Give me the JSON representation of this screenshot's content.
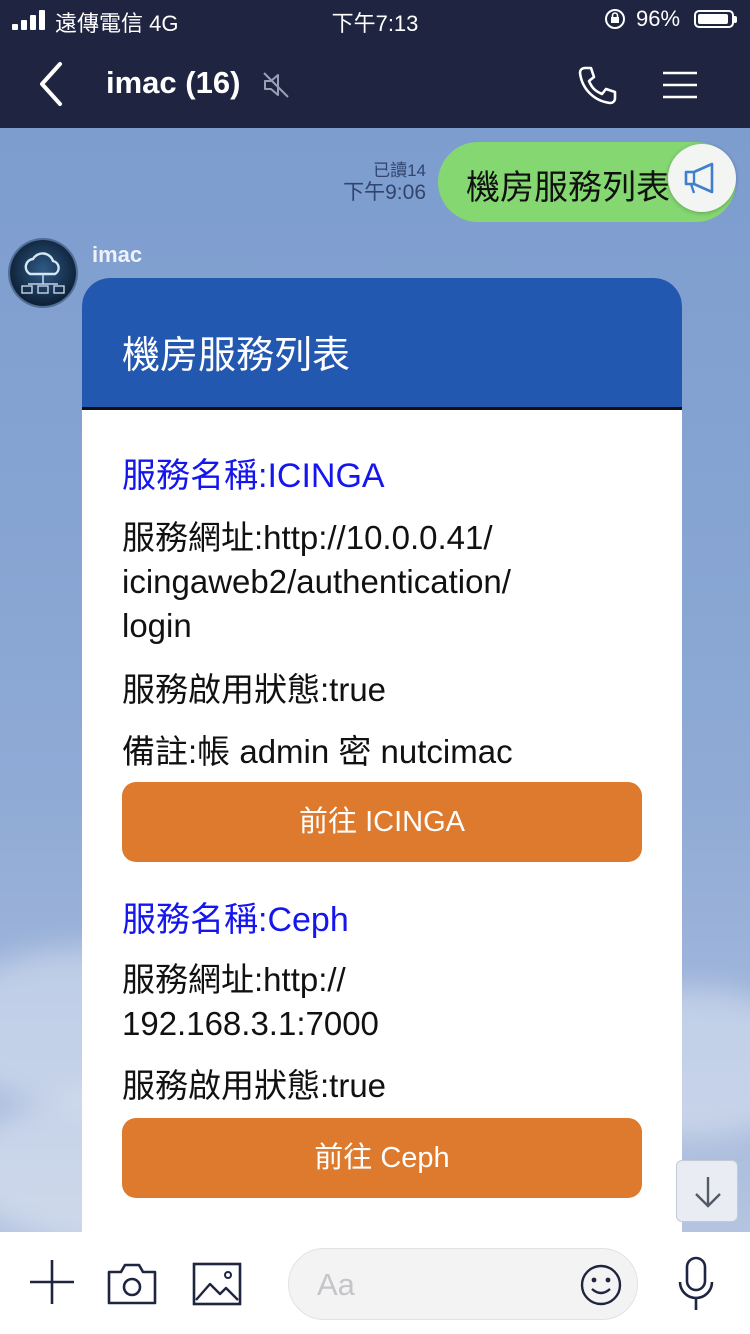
{
  "status_bar": {
    "carrier": "遠傳電信 4G",
    "time": "下午7:13",
    "battery": "96%",
    "battery_level": 0.96
  },
  "header": {
    "title": "imac (16)",
    "icons": [
      "back-icon",
      "mute-icon",
      "phone-icon",
      "menu-icon"
    ]
  },
  "sent_message": {
    "read_status": "已讀14",
    "time": "下午9:06",
    "text": "機房服務列表"
  },
  "incoming": {
    "sender": "imac",
    "card": {
      "title": "機房服務列表",
      "services": [
        {
          "name": "服務名稱:ICINGA",
          "url_lines": [
            "服務網址:http://10.0.0.41/",
            "icingaweb2/authentication/",
            "login"
          ],
          "status": "服務啟用狀態:true",
          "note": "備註:帳 admin 密 nutcimac",
          "button": "前往 ICINGA"
        },
        {
          "name": "服務名稱:Ceph",
          "url_lines": [
            "服務網址:http://",
            "192.168.3.1:7000"
          ],
          "status": "服務啟用狀態:true",
          "button": "前往 Ceph"
        }
      ]
    }
  },
  "input_bar": {
    "placeholder": "Aa",
    "icons": [
      "plus-icon",
      "camera-icon",
      "image-icon",
      "emoji-icon",
      "microphone-icon"
    ]
  },
  "colors": {
    "header_bg": "#1f2540",
    "sent_bubble": "#84d771",
    "card_header": "#2358b0",
    "service_title": "#1515ee",
    "button": "#dd7a2d"
  }
}
